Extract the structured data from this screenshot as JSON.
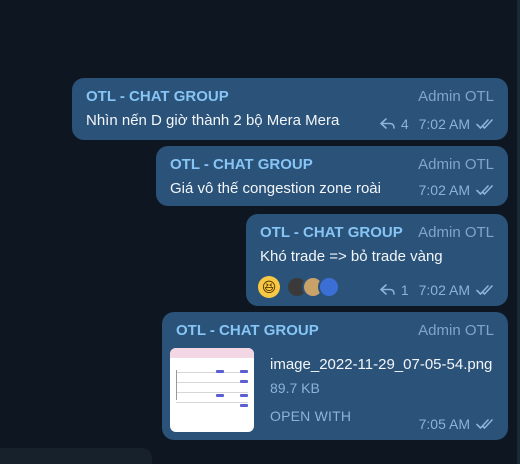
{
  "messages": [
    {
      "sender": "OTL - CHAT GROUP",
      "author_tag": "Admin OTL",
      "text": "Nhìn nến D giờ thành 2 bộ Mera Mera",
      "replies": "4",
      "time": "7:02 AM"
    },
    {
      "sender": "OTL - CHAT GROUP",
      "author_tag": "Admin OTL",
      "text": "Giá vô thế congestion zone roài",
      "time": "7:02 AM"
    },
    {
      "sender": "OTL - CHAT GROUP",
      "author_tag": "Admin OTL",
      "text": "Khó trade => bỏ trade vàng",
      "reaction": "😆",
      "replies": "1",
      "time": "7:02 AM"
    },
    {
      "sender": "OTL - CHAT GROUP",
      "author_tag": "Admin OTL",
      "file_name": "image_2022-11-29_07-05-54.png",
      "file_size": "89.7 KB",
      "open_with": "OPEN WITH",
      "time": "7:05 AM"
    }
  ],
  "colors": {
    "background": "#0e1621",
    "bubble": "#2b5278",
    "sender": "#86c5f5",
    "meta": "#8ab4d8"
  }
}
